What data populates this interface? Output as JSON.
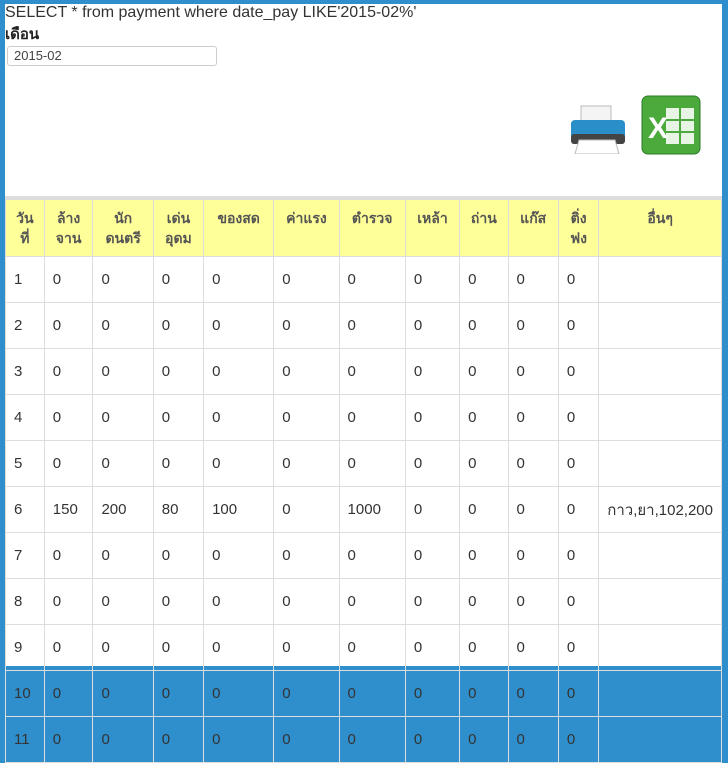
{
  "query": "SELECT * from payment where date_pay LIKE'2015-02%'",
  "month_label": "เดือน",
  "month_value": "2015-02",
  "icons": {
    "print": "printer-icon",
    "excel": "excel-icon"
  },
  "colors": {
    "header_bg": "#ffff99",
    "frame": "#2f8fcc"
  },
  "table": {
    "headers": [
      "วัน ที่",
      "ล้าง จาน",
      "นัก ดนตรี",
      "เด่น อุดม",
      "ของสด",
      "ค่าแรง",
      "ตำรวจ",
      "เหล้า",
      "ถ่าน",
      "แก๊ส",
      "ติ่ง ฟง",
      "อื่นๆ"
    ],
    "rows": [
      [
        "1",
        "0",
        "0",
        "0",
        "0",
        "0",
        "0",
        "0",
        "0",
        "0",
        "0",
        ""
      ],
      [
        "2",
        "0",
        "0",
        "0",
        "0",
        "0",
        "0",
        "0",
        "0",
        "0",
        "0",
        ""
      ],
      [
        "3",
        "0",
        "0",
        "0",
        "0",
        "0",
        "0",
        "0",
        "0",
        "0",
        "0",
        ""
      ],
      [
        "4",
        "0",
        "0",
        "0",
        "0",
        "0",
        "0",
        "0",
        "0",
        "0",
        "0",
        ""
      ],
      [
        "5",
        "0",
        "0",
        "0",
        "0",
        "0",
        "0",
        "0",
        "0",
        "0",
        "0",
        ""
      ],
      [
        "6",
        "150",
        "200",
        "80",
        "100",
        "0",
        "1000",
        "0",
        "0",
        "0",
        "0",
        "กาว,ยา,102,200"
      ],
      [
        "7",
        "0",
        "0",
        "0",
        "0",
        "0",
        "0",
        "0",
        "0",
        "0",
        "0",
        ""
      ],
      [
        "8",
        "0",
        "0",
        "0",
        "0",
        "0",
        "0",
        "0",
        "0",
        "0",
        "0",
        ""
      ],
      [
        "9",
        "0",
        "0",
        "0",
        "0",
        "0",
        "0",
        "0",
        "0",
        "0",
        "0",
        ""
      ],
      [
        "10",
        "0",
        "0",
        "0",
        "0",
        "0",
        "0",
        "0",
        "0",
        "0",
        "0",
        ""
      ],
      [
        "11",
        "0",
        "0",
        "0",
        "0",
        "0",
        "0",
        "0",
        "0",
        "0",
        "0",
        ""
      ]
    ]
  }
}
